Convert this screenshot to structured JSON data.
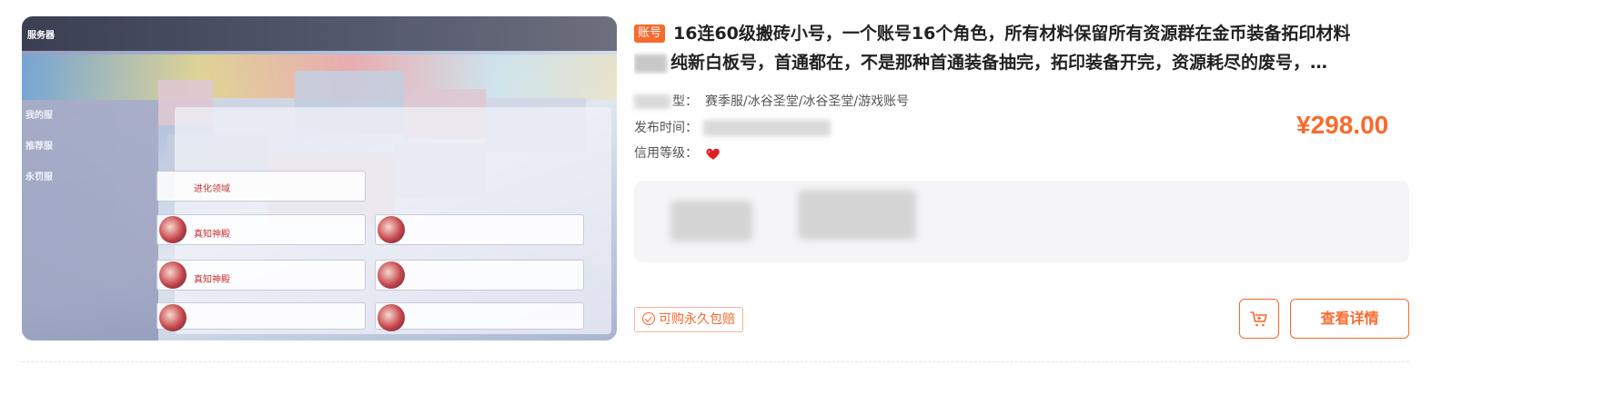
{
  "listing": {
    "tag": "账号",
    "title_line1": "16连60级搬砖小号，一个账号16个角色，所有材料保留所有资源群在金币装备拓印材料",
    "title_line2": "纯新白板号，首通都在，不是那种首通装备抽完，拓印装备开完，资源耗尽的废号，…",
    "type_key": "型：",
    "type_value": "赛季服/冰谷圣堂/冰谷圣堂/游戏账号",
    "publish_key": "发布时间：",
    "credit_key": "信用等级：",
    "price": "¥298.00",
    "guarantee_label": "可购永久包赔",
    "detail_button": "查看详情",
    "icons": {
      "cart": "cart-icon",
      "heart": "heart-icon",
      "guarantee": "check-circle-icon"
    },
    "colors": {
      "accent": "#f96a2d",
      "title": "#222222",
      "meta": "#555555"
    }
  },
  "thumbnail": {
    "topbar_text": "服务器",
    "side_items": [
      "我的服",
      "推荐服",
      "永罚服"
    ],
    "row_labels": [
      "进化领域",
      "真知神殿",
      "真知神殿"
    ]
  }
}
